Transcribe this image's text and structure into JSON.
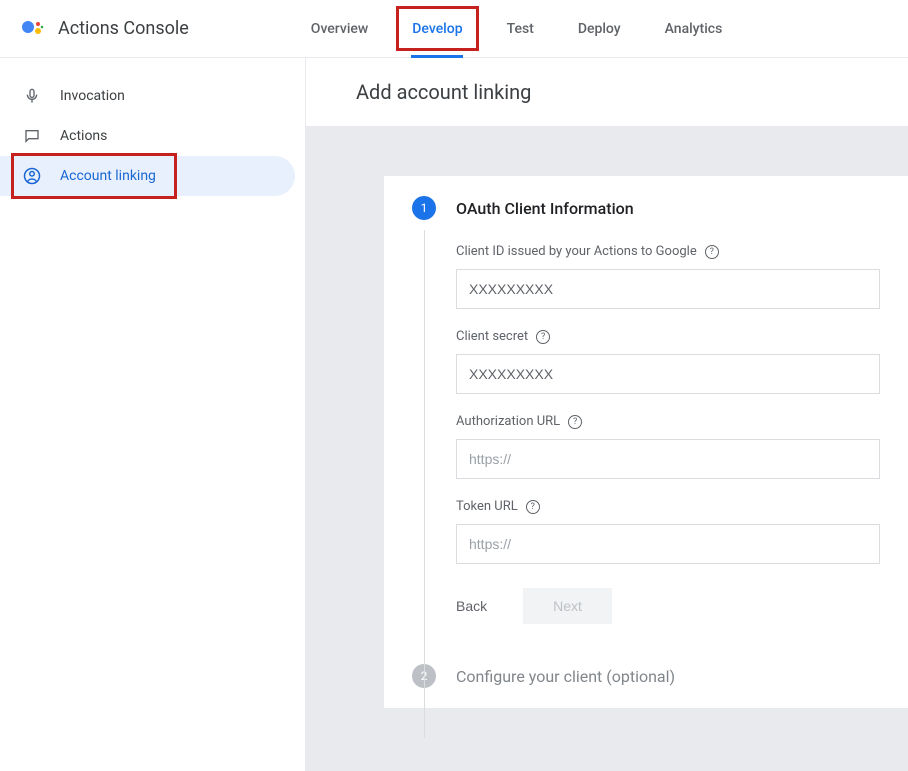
{
  "header": {
    "title": "Actions Console",
    "tabs": [
      {
        "label": "Overview",
        "active": false
      },
      {
        "label": "Develop",
        "active": true
      },
      {
        "label": "Test",
        "active": false
      },
      {
        "label": "Deploy",
        "active": false
      },
      {
        "label": "Analytics",
        "active": false
      }
    ]
  },
  "sidebar": {
    "items": [
      {
        "label": "Invocation",
        "icon": "mic",
        "active": false
      },
      {
        "label": "Actions",
        "icon": "chat",
        "active": false
      },
      {
        "label": "Account linking",
        "icon": "account",
        "active": true
      }
    ]
  },
  "main": {
    "title": "Add account linking",
    "step1": {
      "number": "1",
      "title": "OAuth Client Information",
      "fields": {
        "client_id_label": "Client ID issued by your Actions to Google",
        "client_id_value": "XXXXXXXXX",
        "client_secret_label": "Client secret",
        "client_secret_value": "XXXXXXXXX",
        "auth_url_label": "Authorization URL",
        "auth_url_placeholder": "https://",
        "token_url_label": "Token URL",
        "token_url_placeholder": "https://"
      },
      "back_label": "Back",
      "next_label": "Next"
    },
    "step2": {
      "number": "2",
      "title": "Configure your client (optional)"
    }
  }
}
